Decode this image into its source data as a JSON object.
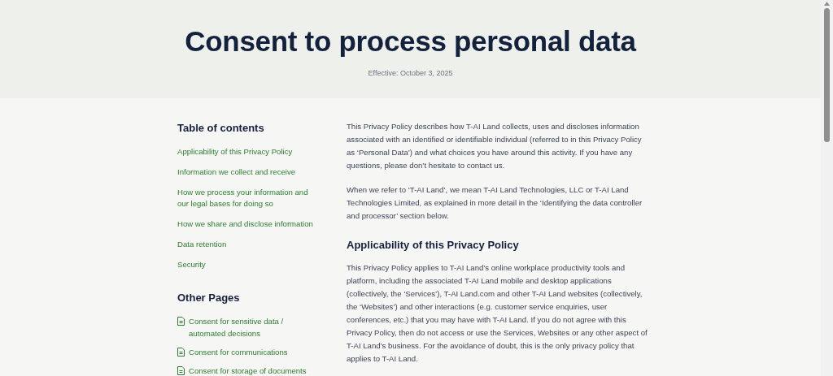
{
  "header": {
    "title": "Consent to process personal data",
    "effective": "Effective: October 3, 2025"
  },
  "toc": {
    "heading": "Table of contents",
    "items": [
      {
        "label": "Applicability of this Privacy Policy"
      },
      {
        "label": "Information we collect and receive"
      },
      {
        "label": "How we process your information and our legal bases for doing so"
      },
      {
        "label": "How we share and disclose information"
      },
      {
        "label": "Data retention"
      },
      {
        "label": "Security"
      }
    ]
  },
  "other_pages": {
    "heading": "Other Pages",
    "items": [
      {
        "label": "Consent for sensitive data / automated decisions"
      },
      {
        "label": "Consent for communications"
      },
      {
        "label": "Consent for storage of documents"
      }
    ]
  },
  "content": [
    {
      "kind": "paragraph",
      "text": "This Privacy Policy describes how T-AI Land collects, uses and discloses information associated with an identified or identifiable individual (referred to in this Privacy Policy as ‘Personal Data’) and what choices you have around this activity. If you have any questions, please don’t hesitate to contact us."
    },
    {
      "kind": "paragraph",
      "text": "When we refer to ‘T-AI Land’, we mean T-AI Land Technologies, LLC or T-AI Land Technologies Limited, as explained in more detail in the ‘Identifying the data controller and processor’ section below."
    },
    {
      "kind": "heading",
      "text": "Applicability of this Privacy Policy"
    },
    {
      "kind": "paragraph",
      "text": "This Privacy Policy applies to T-AI Land’s online workplace productivity tools and platform, including the associated T-AI Land mobile and desktop applications (collectively, the ‘Services’), T-AI Land.com and other T-AI Land websites (collectively, the ‘Websites’) and other interactions (e.g. customer service enquiries, user conferences, etc.) that you may have with T-AI Land. If you do not agree with this Privacy Policy, then do not access or use the Services, Websites or any other aspect of T-AI Land’s business. For the avoidance of doubt, this is the only privacy policy that applies to T-AI Land."
    }
  ]
}
